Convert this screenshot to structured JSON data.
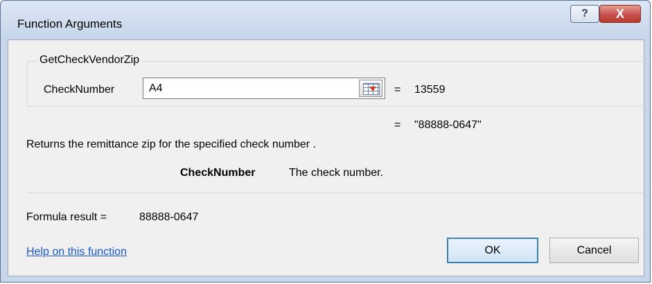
{
  "window": {
    "title": "Function Arguments"
  },
  "titlebar": {
    "help_glyph": "?",
    "close_glyph": "X"
  },
  "function": {
    "name": "GetCheckVendorZip",
    "argument": {
      "label": "CheckNumber",
      "value": "A4",
      "evaluated": "13559"
    },
    "equals": "=",
    "return_preview": "\"88888-0647\"",
    "description": "Returns the remittance zip for the specified check number .",
    "arg_help_name": "CheckNumber",
    "arg_help_text": "The check number."
  },
  "result": {
    "label": "Formula result =",
    "value": "88888-0647"
  },
  "footer": {
    "help_link": "Help on this function",
    "ok_label": "OK",
    "cancel_label": "Cancel"
  },
  "icons": {
    "help": "help-icon",
    "close": "close-icon",
    "collapse": "collapse-dialog-icon"
  }
}
